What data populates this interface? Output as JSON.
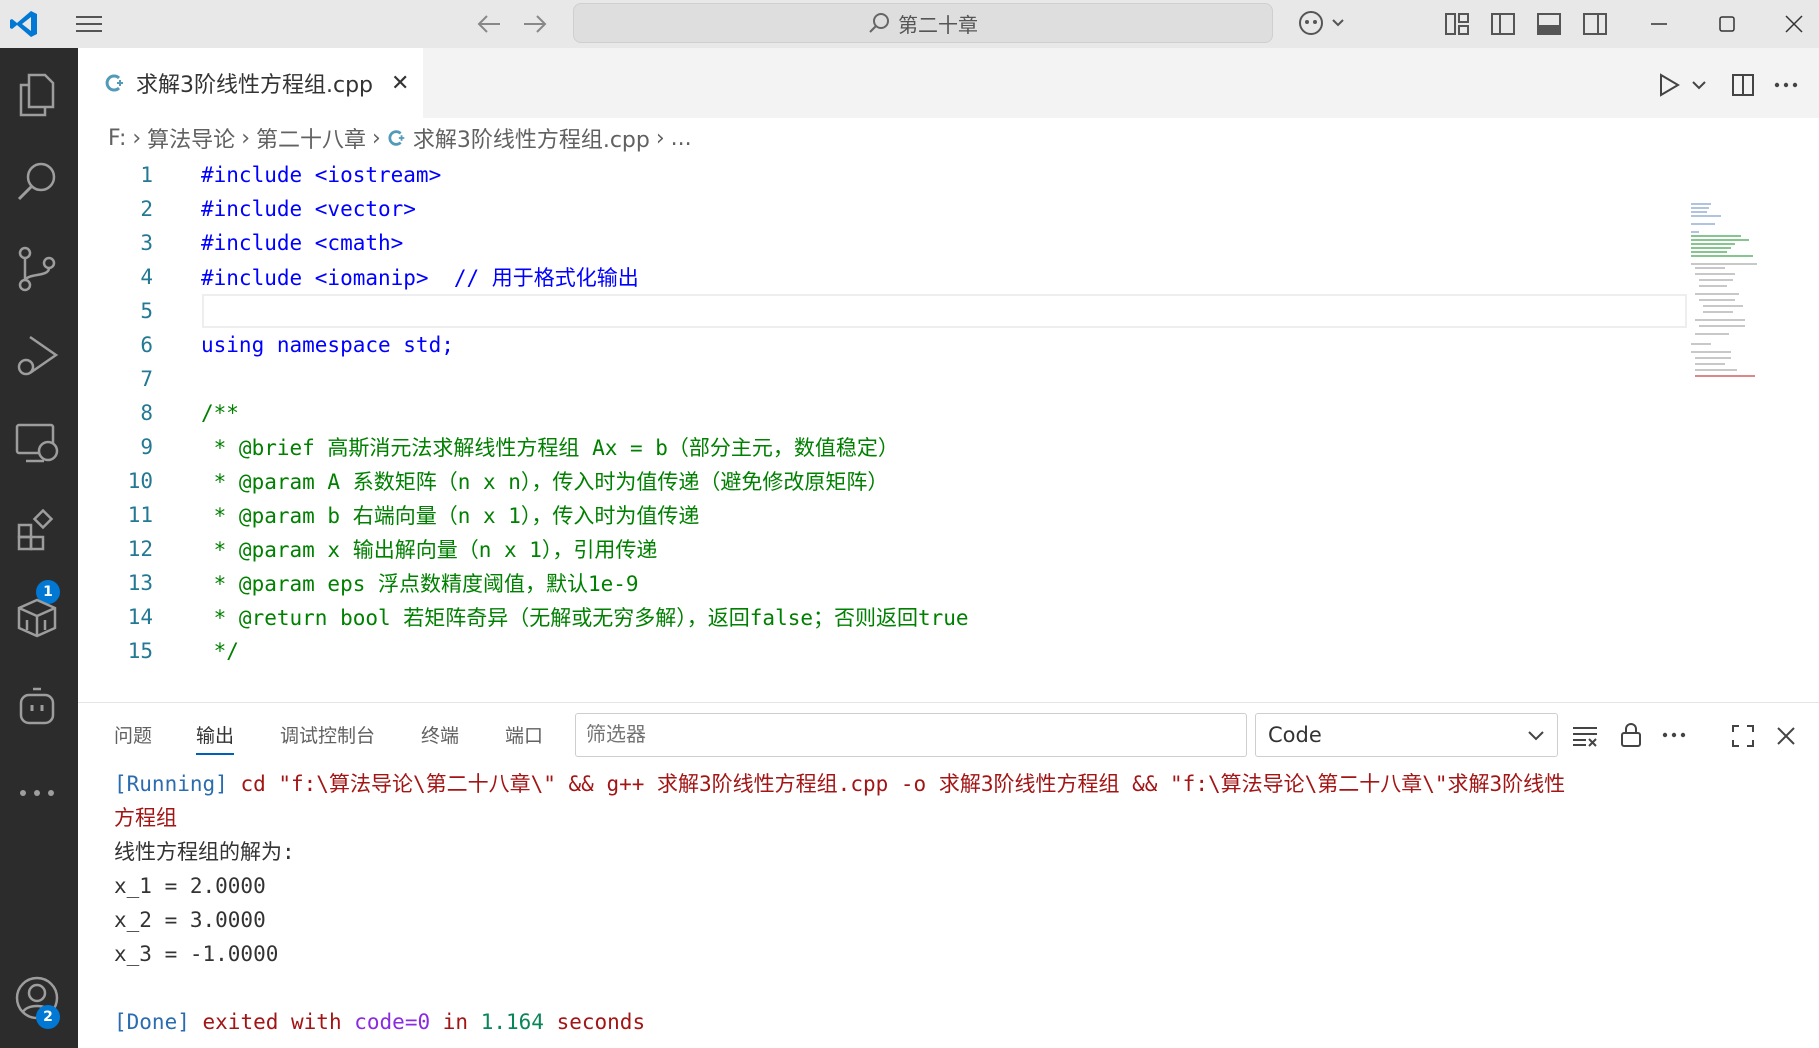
{
  "titlebar": {
    "search_text": "第二十章"
  },
  "activity": {
    "extensions_badge": "1",
    "accounts_badge": "2"
  },
  "tab": {
    "filename": "求解3阶线性方程组.cpp",
    "close": "✕"
  },
  "breadcrumb": {
    "drive": "F:",
    "folder1": "算法导论",
    "folder2": "第二十八章",
    "file": "求解3阶线性方程组.cpp",
    "more": "..."
  },
  "code": {
    "lines": [
      {
        "n": "1",
        "t": "#include <iostream>"
      },
      {
        "n": "2",
        "t": "#include <vector>"
      },
      {
        "n": "3",
        "t": "#include <cmath>"
      },
      {
        "n": "4",
        "t": "#include <iomanip>  // 用于格式化输出"
      },
      {
        "n": "5",
        "t": ""
      },
      {
        "n": "6",
        "t": "using namespace std;"
      },
      {
        "n": "7",
        "t": ""
      },
      {
        "n": "8",
        "t": "/**"
      },
      {
        "n": "9",
        "t": " * @brief 高斯消元法求解线性方程组 Ax = b（部分主元，数值稳定）"
      },
      {
        "n": "10",
        "t": " * @param A 系数矩阵（n x n），传入时为值传递（避免修改原矩阵）"
      },
      {
        "n": "11",
        "t": " * @param b 右端向量（n x 1），传入时为值传递"
      },
      {
        "n": "12",
        "t": " * @param x 输出解向量（n x 1），引用传递"
      },
      {
        "n": "13",
        "t": " * @param eps 浮点数精度阈值，默认1e-9"
      },
      {
        "n": "14",
        "t": " * @return bool 若矩阵奇异（无解或无穷多解），返回false；否则返回true"
      },
      {
        "n": "15",
        "t": " */"
      }
    ]
  },
  "panel": {
    "tabs": [
      "问题",
      "输出",
      "调试控制台",
      "终端",
      "端口"
    ],
    "active_tab": "输出",
    "filter_placeholder": "筛选器",
    "channel": "Code",
    "output": {
      "running_tag": "[Running]",
      "running_cmd": "cd \"f:\\算法导论\\第二十八章\\\" && g++ 求解3阶线性方程组.cpp -o 求解3阶线性方程组 && \"f:\\算法导论\\第二十八章\\\"求解3阶线性",
      "running_cmd_cont": "方程组",
      "lines": [
        "线性方程组的解为:",
        "x_1 = 2.0000",
        "x_2 = 3.0000",
        "x_3 = -1.0000"
      ],
      "done_tag": "[Done]",
      "done_text1": "exited with",
      "done_code": "code=0",
      "done_text2": "in",
      "done_time": "1.164",
      "done_text3": "seconds"
    }
  },
  "colors": {
    "accent": "#005fb8",
    "activity_bg": "#2c2c2c",
    "titlebar_bg": "#e8e8e8",
    "badge": "#0078d4"
  }
}
